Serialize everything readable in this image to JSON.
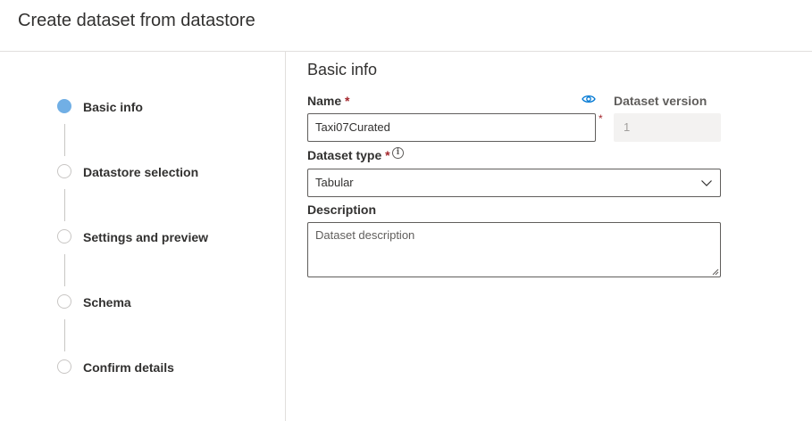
{
  "header": {
    "title": "Create dataset from datastore"
  },
  "wizard": {
    "steps": [
      {
        "label": "Basic info",
        "active": true
      },
      {
        "label": "Datastore selection",
        "active": false
      },
      {
        "label": "Settings and preview",
        "active": false
      },
      {
        "label": "Schema",
        "active": false
      },
      {
        "label": "Confirm details",
        "active": false
      }
    ]
  },
  "form": {
    "section_title": "Basic info",
    "name": {
      "label": "Name",
      "required_mark": "*",
      "value": "Taxi07Curated",
      "icon": "eye-icon"
    },
    "version": {
      "label": "Dataset version",
      "value": "1",
      "required_mark": "*"
    },
    "dataset_type": {
      "label": "Dataset type",
      "required_mark": "*",
      "info_icon": "i",
      "value": "Tabular"
    },
    "description": {
      "label": "Description",
      "placeholder": "Dataset description"
    }
  },
  "colors": {
    "accent": "#0078d4",
    "active_step": "#71afe5",
    "required": "#a4262c",
    "border": "#605e5c",
    "divider": "#e1dfdd"
  }
}
